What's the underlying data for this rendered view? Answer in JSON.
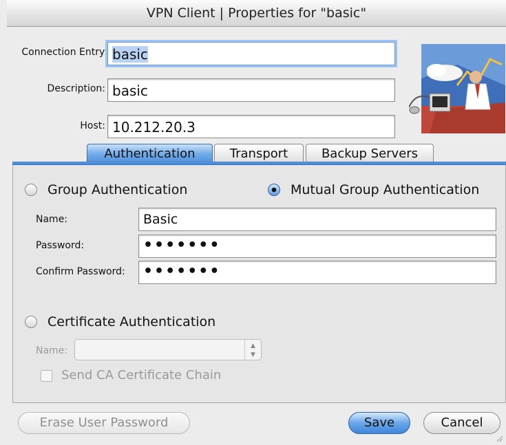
{
  "window": {
    "title": "VPN Client  |  Properties for \"basic\""
  },
  "entry": {
    "connection_label": "Connection Entry:",
    "connection_value": "basic",
    "description_label": "Description:",
    "description_value": "basic",
    "host_label": "Host:",
    "host_value": "10.212.20.3"
  },
  "tabs": [
    {
      "label": "Authentication",
      "active": true
    },
    {
      "label": "Transport",
      "active": false
    },
    {
      "label": "Backup Servers",
      "active": false
    }
  ],
  "auth": {
    "group_label": "Group Authentication",
    "group_selected": false,
    "mutual_label": "Mutual Group Authentication",
    "mutual_selected": true,
    "name_label": "Name:",
    "name_value": "Basic",
    "password_label": "Password:",
    "password_value": "•••••••",
    "confirm_label": "Confirm Password:",
    "confirm_value": "•••••••",
    "cert_label": "Certificate Authentication",
    "cert_selected": false,
    "cert_name_label": "Name:",
    "cert_name_value": "",
    "send_ca_label": "Send CA Certificate Chain",
    "send_ca_checked": false
  },
  "buttons": {
    "erase_label": "Erase User Password",
    "save_label": "Save",
    "cancel_label": "Cancel"
  },
  "colors": {
    "accent": "#4b8ddc",
    "focus_ring": "#9ec3f0"
  }
}
